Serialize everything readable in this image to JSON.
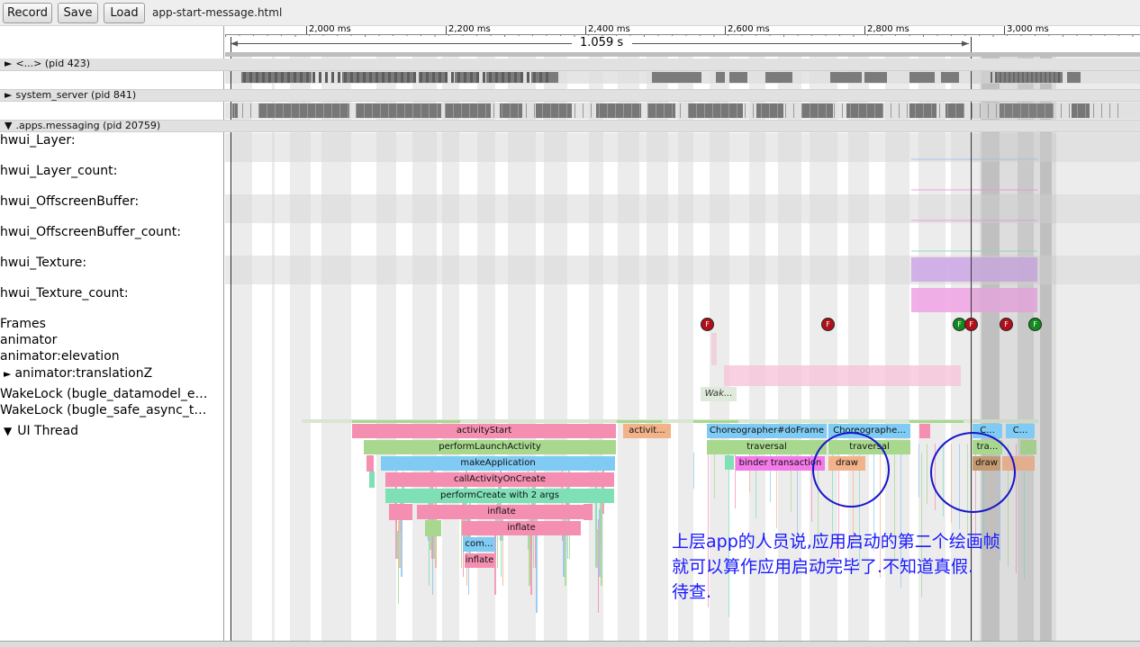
{
  "toolbar": {
    "record_label": "Record",
    "save_label": "Save",
    "load_label": "Load",
    "filename": "app-start-message.html"
  },
  "ruler": {
    "ticks": [
      "2,000 ms",
      "2,200 ms",
      "2,400 ms",
      "2,600 ms",
      "2,800 ms",
      "3,000 ms"
    ],
    "duration": "1.059 s"
  },
  "processes": [
    {
      "name": "<...> (pid 423)",
      "expander": "►"
    },
    {
      "name": "system_server (pid 841)",
      "expander": "►"
    },
    {
      "name": ".apps.messaging (pid 20759)",
      "expander": "▼"
    }
  ],
  "track_labels": {
    "hwui_layer": "hwui_Layer:",
    "hwui_layer_count": "hwui_Layer_count:",
    "hwui_offscreen": "hwui_OffscreenBuffer:",
    "hwui_offscreen_count": "hwui_OffscreenBuffer_count:",
    "hwui_texture": "hwui_Texture:",
    "hwui_texture_count": "hwui_Texture_count:",
    "frames": "Frames",
    "animator": "animator",
    "animator_elevation": "animator:elevation",
    "animator_translationz": "animator:translationZ",
    "animator_translationz_expander": "►",
    "wakelock1": "WakeLock (bugle_datamodel_e…",
    "wakelock2": "WakeLock (bugle_safe_async_t…",
    "ui_thread": "UI Thread",
    "ui_thread_expander": "▼"
  },
  "frame_marker_letter": "F",
  "slices": {
    "activity_start": "activityStart",
    "activit_short": "activit...",
    "choreographer1": "Choreographer#doFrame",
    "choreographer2": "Choreographe...",
    "c1": "C...",
    "c2": "C...",
    "perform_launch": "performLaunchActivity",
    "traversal1": "traversal",
    "traversal2": "traversal",
    "tra_short": "tra...",
    "make_application": "makeApplication",
    "binder": "binder transaction",
    "draw1": "draw",
    "draw2": "draw",
    "call_on_create": "callActivityOnCreate",
    "perform_create": "performCreate with 2 args",
    "inflate1": "inflate",
    "inflate2": "inflate",
    "com_short": "com...",
    "inflate3": "inflate",
    "wakelock_slice": "Wak..."
  },
  "annotation": "上层app的人员说,应用启动的第二个绘画帧\n就可以算作应用启动完毕了.不知道真假.\n待查.",
  "colors": {
    "frame_red": "#b0101a",
    "frame_green": "#138a1f",
    "annotation_blue": "#1a1aff"
  }
}
